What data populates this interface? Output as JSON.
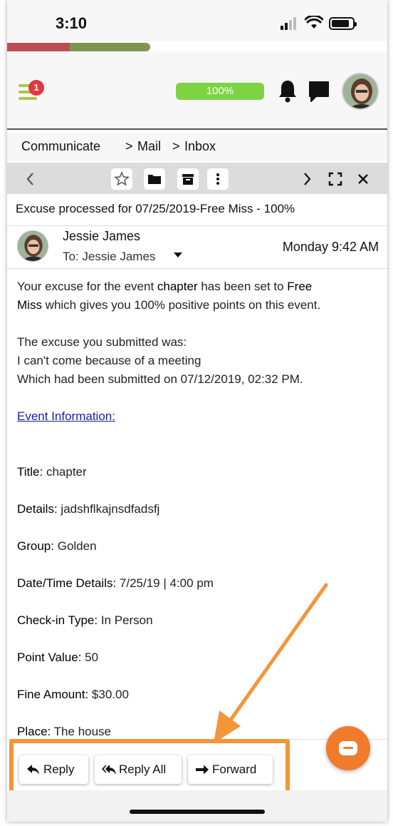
{
  "status_bar": {
    "time": "3:10"
  },
  "header": {
    "menu_badge": "1",
    "completion_pill": "100%"
  },
  "breadcrumb": {
    "item1": "Communicate",
    "item2": "Mail",
    "item3": "Inbox"
  },
  "message": {
    "subject": "Excuse processed for 07/25/2019-Free Miss - 100%",
    "sender": "Jessie James",
    "to_label": "To:",
    "to_value": "Jessie James",
    "date": "Monday 9:42 AM",
    "para1_a": "Your excuse for the event ",
    "para1_event": "chapter",
    "para1_b": " has been set to ",
    "para1_status1": "Free",
    "para1_status2": "Miss",
    "para1_c": " which gives you 100% positive points on this event.",
    "line1": "The excuse you submitted was:",
    "line2": "I can't come because of a meeting",
    "line3": "Which had been submitted on 07/12/2019, 02:32 PM.",
    "event_link": "Event Information:",
    "fields": [
      {
        "label": "Title:",
        "value": "chapter"
      },
      {
        "label": "Details:",
        "value": "jadshflkajnsdfadsfj"
      },
      {
        "label": "Group:",
        "value": "Golden"
      },
      {
        "label": "Date/Time Details:",
        "value": "7/25/19 | 4:00 pm"
      },
      {
        "label": "Check-in Type:",
        "value": "In Person"
      },
      {
        "label": "Point Value:",
        "value": "50"
      },
      {
        "label": "Fine Amount:",
        "value": "$30.00"
      },
      {
        "label": "Place:",
        "value": "The house"
      }
    ]
  },
  "actions": {
    "reply": "Reply",
    "reply_all": "Reply All",
    "forward": "Forward"
  },
  "colors": {
    "highlight": "#f3963a",
    "progress_red": "#bf4b55",
    "progress_green": "#7f9651",
    "pill_green": "#7dd344",
    "link_blue": "#1c1ca8"
  }
}
